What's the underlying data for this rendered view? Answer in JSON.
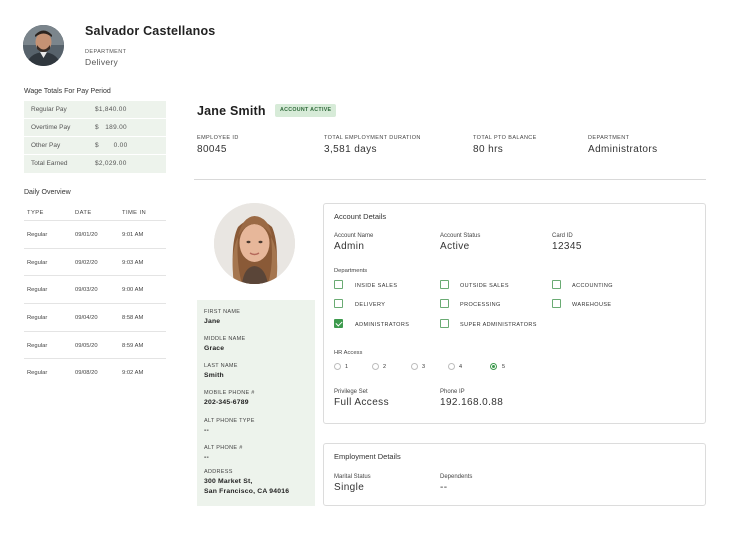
{
  "header": {
    "user_name": "Salvador Castellanos",
    "department_label": "DEPARTMENT",
    "department_value": "Delivery"
  },
  "wage_totals": {
    "title": "Wage Totals For Pay Period",
    "rows": [
      {
        "label": "Regular Pay",
        "value": "$1,840.00"
      },
      {
        "label": "Overtime Pay",
        "value": "$   189.00"
      },
      {
        "label": "Other Pay",
        "value": "$       0.00"
      },
      {
        "label": "Total Earned",
        "value": "$2,029.00"
      }
    ]
  },
  "daily_overview": {
    "title": "Daily Overview",
    "columns": [
      "TYPE",
      "DATE",
      "TIME IN"
    ],
    "rows": [
      {
        "type": "Regular",
        "date": "09/01/20",
        "time_in": "9:01 AM"
      },
      {
        "type": "Regular",
        "date": "09/02/20",
        "time_in": "9:03 AM"
      },
      {
        "type": "Regular",
        "date": "09/03/20",
        "time_in": "9:00 AM"
      },
      {
        "type": "Regular",
        "date": "09/04/20",
        "time_in": "8:58 AM"
      },
      {
        "type": "Regular",
        "date": "09/05/20",
        "time_in": "8:59 AM"
      },
      {
        "type": "Regular",
        "date": "09/08/20",
        "time_in": "9:02 AM"
      }
    ]
  },
  "employee": {
    "name": "Jane Smith",
    "status_badge": "ACCOUNT ACTIVE",
    "stats": [
      {
        "label": "EMPLOYEE ID",
        "value": "80045"
      },
      {
        "label": "TOTAL EMPLOYMENT DURATION",
        "value": "3,581 days"
      },
      {
        "label": "TOTAL PTO BALANCE",
        "value": "80 hrs"
      },
      {
        "label": "DEPARTMENT",
        "value": "Administrators"
      }
    ],
    "info": [
      {
        "label": "FIRST NAME",
        "value": "Jane"
      },
      {
        "label": "MIDDLE NAME",
        "value": "Grace"
      },
      {
        "label": "LAST NAME",
        "value": "Smith"
      },
      {
        "label": "MOBILE PHONE #",
        "value": "202-345-6789"
      },
      {
        "label": "ALT PHONE TYPE",
        "value": "--"
      },
      {
        "label": "ALT PHONE #",
        "value": "--"
      },
      {
        "label": "ADDRESS",
        "value_line1": "300 Market St,",
        "value_line2": "San Francisco, CA 94016"
      }
    ]
  },
  "account_details": {
    "title": "Account Details",
    "fields": [
      {
        "label": "Account Name",
        "value": "Admin"
      },
      {
        "label": "Account Status",
        "value": "Active"
      },
      {
        "label": "Card ID",
        "value": "12345"
      }
    ],
    "departments_label": "Departments",
    "departments": [
      {
        "label": "INSIDE SALES",
        "checked": false
      },
      {
        "label": "OUTSIDE SALES",
        "checked": false
      },
      {
        "label": "ACCOUNTING",
        "checked": false
      },
      {
        "label": "DELIVERY",
        "checked": false
      },
      {
        "label": "PROCESSING",
        "checked": false
      },
      {
        "label": "WAREHOUSE",
        "checked": false
      },
      {
        "label": "ADMINISTRATORS",
        "checked": true
      },
      {
        "label": "SUPER ADMINISTRATORS",
        "checked": false
      }
    ],
    "hr_access_label": "HR Access",
    "hr_access_options": [
      "1",
      "2",
      "3",
      "4",
      "5"
    ],
    "hr_access_selected": "5",
    "privilege_label": "Privilege Set",
    "privilege_value": "Full Access",
    "phone_ip_label": "Phone IP",
    "phone_ip_value": "192.168.0.88"
  },
  "employment_details": {
    "title": "Employment Details",
    "marital_label": "Marital Status",
    "marital_value": "Single",
    "dependents_label": "Dependents",
    "dependents_value": "--"
  },
  "colors": {
    "accent_green": "#3d9a4d",
    "panel_green": "#edf3ec",
    "badge_bg": "#d7ebd8"
  }
}
